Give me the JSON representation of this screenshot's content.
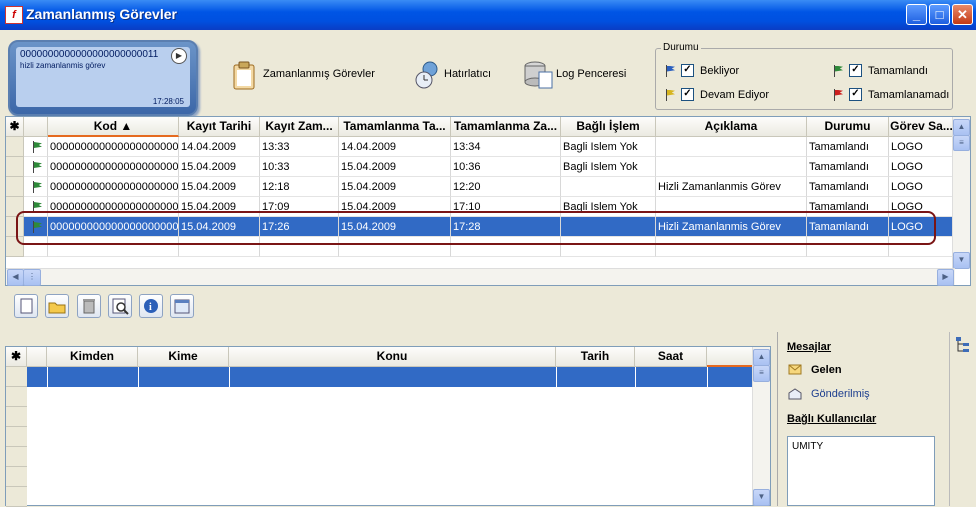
{
  "window": {
    "title": "Zamanlanmış Görevler"
  },
  "widget": {
    "code": "0000000000000000000000011",
    "subtitle": "hizli zamanlanmis görev",
    "time": "17:28:05"
  },
  "toolbar": {
    "items": [
      {
        "label": "Zamanlanmış Görevler",
        "icon": "clipboard-icon"
      },
      {
        "label": "Hatırlatıcı",
        "icon": "reminder-clock-icon"
      },
      {
        "label": "Log Penceresi",
        "icon": "database-log-icon"
      }
    ]
  },
  "status": {
    "legend": "Durumu",
    "items": [
      {
        "label": "Bekliyor",
        "color": "#2a5fbf",
        "checked": true
      },
      {
        "label": "Devam Ediyor",
        "color": "#d6b521",
        "checked": true
      },
      {
        "label": "Tamamlandı",
        "color": "#2f8a3a",
        "checked": true
      },
      {
        "label": "Tamamlanamadı",
        "color": "#cc1f1f",
        "checked": true
      }
    ]
  },
  "grid": {
    "columns": [
      "Kod",
      "Kayıt Tarihi",
      "Kayıt Zam...",
      "Tamamlanma Ta...",
      "Tamamlanma Za...",
      "Bağlı İşlem",
      "Açıklama",
      "Durumu",
      "Görev Sa..."
    ],
    "rows": [
      [
        "0000000000000000000000000",
        "14.04.2009",
        "13:33",
        "14.04.2009",
        "13:34",
        "Bagli Islem Yok",
        "",
        "Tamamlandı",
        "LOGO"
      ],
      [
        "0000000000000000000000000",
        "15.04.2009",
        "10:33",
        "15.04.2009",
        "10:36",
        "Bagli Islem Yok",
        "",
        "Tamamlandı",
        "LOGO"
      ],
      [
        "0000000000000000000000000",
        "15.04.2009",
        "12:18",
        "15.04.2009",
        "12:20",
        "",
        "Hizli Zamanlanmis Görev",
        "Tamamlandı",
        "LOGO"
      ],
      [
        "0000000000000000000000000",
        "15.04.2009",
        "17:09",
        "15.04.2009",
        "17:10",
        "Bagli Islem Yok",
        "",
        "Tamamlandı",
        "LOGO"
      ],
      [
        "0000000000000000000000000",
        "15.04.2009",
        "17:26",
        "15.04.2009",
        "17:28",
        "",
        "Hizli Zamanlanmis Görev",
        "Tamamlandı",
        "LOGO"
      ]
    ],
    "selected_row": 4,
    "flag_color": "#2f8a3a"
  },
  "buttons": [
    "new-document-icon",
    "open-folder-icon",
    "trash-icon",
    "preview-icon",
    "info-icon",
    "schedule-icon"
  ],
  "messages_grid": {
    "columns": [
      "Kimden",
      "Kime",
      "Konu",
      "Tarih",
      "Saat"
    ]
  },
  "right_panel": {
    "messages_title": "Mesajlar",
    "inbox": "Gelen",
    "sent": "Gönderilmiş",
    "users_title": "Bağlı Kullanıcılar",
    "users": [
      "UMITY"
    ]
  }
}
